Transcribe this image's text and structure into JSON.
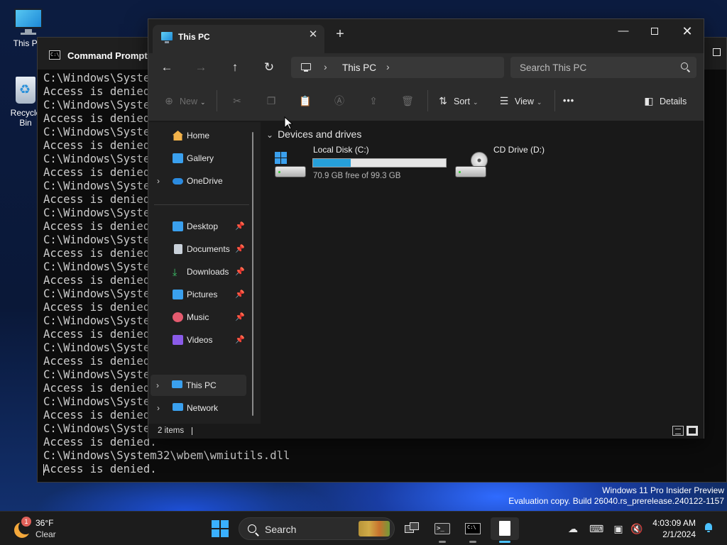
{
  "desktop": {
    "icons": [
      {
        "label": "This PC"
      },
      {
        "label": "Recycle Bin"
      }
    ]
  },
  "cmd": {
    "title": "Command Prompt - ",
    "lines": [
      "C:\\Windows\\System",
      "Access is denied",
      "C:\\Windows\\System",
      "Access is denied",
      "C:\\Windows\\System",
      "Access is denied",
      "C:\\Windows\\System",
      "Access is denied",
      "C:\\Windows\\System",
      "Access is denied",
      "C:\\Windows\\System",
      "Access is denied",
      "C:\\Windows\\System",
      "Access is denied",
      "C:\\Windows\\System",
      "Access is denied",
      "C:\\Windows\\System",
      "Access is denied",
      "C:\\Windows\\System",
      "Access is denied",
      "C:\\Windows\\System",
      "Access is denied",
      "C:\\Windows\\System",
      "Access is denied",
      "C:\\Windows\\System",
      "Access is denied",
      "C:\\Windows\\System",
      "Access is denied.",
      "C:\\Windows\\System32\\wbem\\wmiutils.dll",
      "Access is denied."
    ]
  },
  "explorer": {
    "tab_title": "This PC",
    "address": {
      "segment": "This PC"
    },
    "search_placeholder": "Search This PC",
    "command_bar": {
      "new_label": "New",
      "sort_label": "Sort",
      "view_label": "View",
      "more_label": "•••",
      "details_label": "Details"
    },
    "sidebar": {
      "top": [
        {
          "label": "Home",
          "icon": "home-icon",
          "color": "#f3b34a"
        },
        {
          "label": "Gallery",
          "icon": "gallery-icon",
          "color": "#3aa0ee"
        },
        {
          "label": "OneDrive",
          "icon": "onedrive-icon",
          "color": "#2b8be0"
        }
      ],
      "pinned": [
        {
          "label": "Desktop",
          "icon": "desktop-icon",
          "color": "#3aa0ee"
        },
        {
          "label": "Documents",
          "icon": "documents-icon",
          "color": "#c9d1da"
        },
        {
          "label": "Downloads",
          "icon": "downloads-icon",
          "color": "#3fc76b"
        },
        {
          "label": "Pictures",
          "icon": "pictures-icon",
          "color": "#3aa0ee"
        },
        {
          "label": "Music",
          "icon": "music-icon",
          "color": "#e45b6f"
        },
        {
          "label": "Videos",
          "icon": "videos-icon",
          "color": "#8a5be8"
        }
      ],
      "bottom": [
        {
          "label": "This PC",
          "icon": "this-pc-icon",
          "color": "#3aa0ee"
        },
        {
          "label": "Network",
          "icon": "network-icon",
          "color": "#3aa0ee"
        }
      ]
    },
    "group_title": "Devices and drives",
    "drives": [
      {
        "name": "Local Disk (C:)",
        "usage": "70.9 GB free of 99.3 GB",
        "used_fraction": 0.286
      },
      {
        "name": "CD Drive (D:)"
      }
    ],
    "status": {
      "items": "2 items"
    }
  },
  "watermark": {
    "line1": "Windows 11 Pro Insider Preview",
    "line2": "Evaluation copy. Build 26040.rs_prerelease.240122-1157"
  },
  "taskbar": {
    "weather": {
      "temp": "36°F",
      "desc": "Clear",
      "badge": "1"
    },
    "search_label": "Search",
    "clock": {
      "time": "4:03:09 AM",
      "date": "2/1/2024"
    }
  }
}
